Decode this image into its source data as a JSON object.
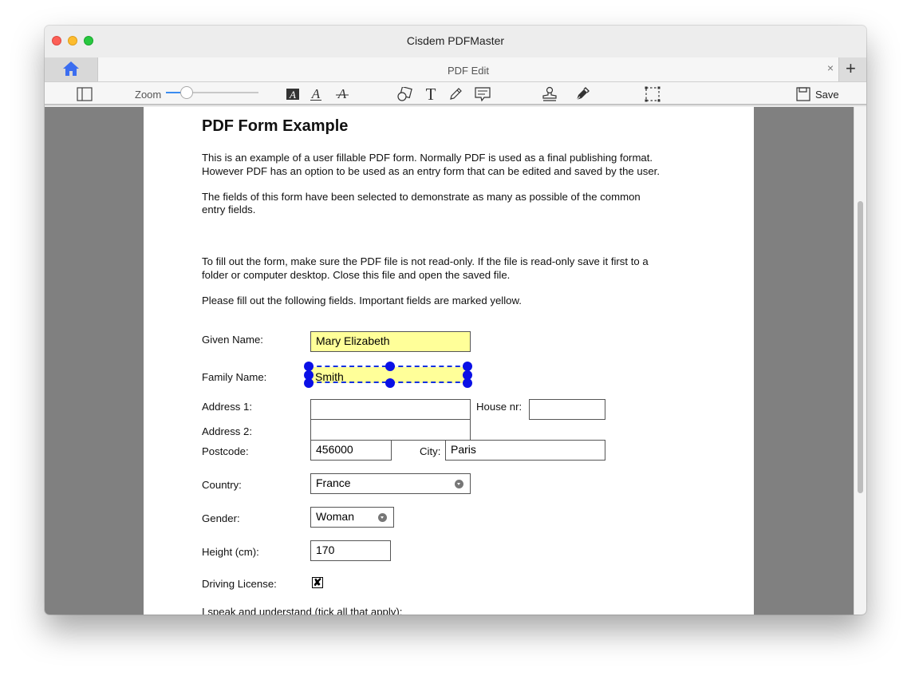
{
  "window": {
    "title": "Cisdem PDFMaster"
  },
  "tabs": {
    "active_label": "PDF Edit",
    "close_glyph": "×",
    "add_glyph": "+"
  },
  "toolbar": {
    "zoom_label": "Zoom",
    "zoom_level": 0.05,
    "save_label": "Save",
    "icons": [
      "sidebar-icon",
      "text-edit-icon",
      "text-style-icon",
      "strikethrough-icon",
      "shape-icon",
      "text-box-icon",
      "pencil-icon",
      "comment-icon",
      "stamp-icon",
      "signature-pen-icon",
      "crop-icon",
      "save-icon"
    ]
  },
  "colors": {
    "accent": "#3b8cf0",
    "field_highlight": "#ffff99",
    "selection": "#0a10e6",
    "canvas": "#808080"
  },
  "pdf": {
    "title": "PDF Form Example",
    "para1_line1": "This is an example of a user fillable PDF form. Normally PDF is used as a final publishing format.",
    "para1_line2": "However PDF has an option to be used as an entry form that can be edited and saved by the user.",
    "para2_line1": "The fields of this form have been selected to demonstrate as many as possible of the common",
    "para2_line2": "entry fields.",
    "para3_line1": "To fill out the form, make sure the PDF file is not read-only. If the file is read-only save it first to a",
    "para3_line2": "folder or computer desktop. Close this file and open the saved file.",
    "para4": "Please fill out the following fields. Important fields are marked yellow.",
    "labels": {
      "given_name": "Given Name:",
      "family_name": "Family Name:",
      "address1": "Address 1:",
      "house_nr": "House nr:",
      "address2": "Address 2:",
      "postcode": "Postcode:",
      "city": "City:",
      "country": "Country:",
      "gender": "Gender:",
      "height": "Height (cm):",
      "driving_license": "Driving License:",
      "languages": "I speak and understand (tick all that apply):"
    },
    "values": {
      "given_name": "Mary Elizabeth",
      "family_name": "Smith",
      "address1": "",
      "house_nr": "",
      "address2": "",
      "postcode": "456000",
      "city": "Paris",
      "country": "France",
      "gender": "Woman",
      "height": "170",
      "driving_license_mark": "✘"
    }
  }
}
